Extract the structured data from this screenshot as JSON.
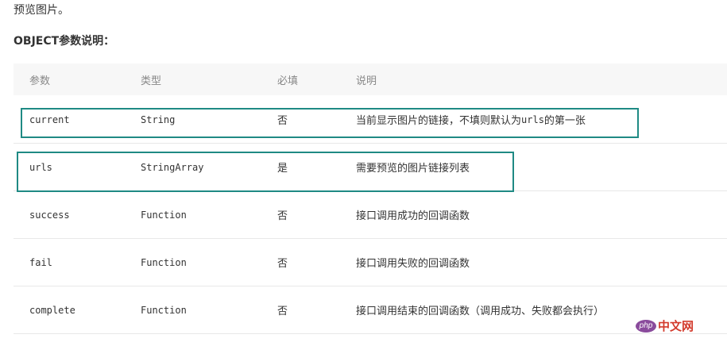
{
  "intro_text": "预览图片。",
  "section_title": "OBJECT参数说明：",
  "table": {
    "headers": {
      "param": "参数",
      "type": "类型",
      "required": "必填",
      "description": "说明"
    },
    "rows": [
      {
        "param": "current",
        "type": "String",
        "required": "否",
        "description_before": "当前显示图片的链接，不填则默认为 ",
        "description_code": "urls",
        "description_after": " 的第一张"
      },
      {
        "param": "urls",
        "type": "StringArray",
        "required": "是",
        "description": "需要预览的图片链接列表"
      },
      {
        "param": "success",
        "type": "Function",
        "required": "否",
        "description": "接口调用成功的回调函数"
      },
      {
        "param": "fail",
        "type": "Function",
        "required": "否",
        "description": "接口调用失败的回调函数"
      },
      {
        "param": "complete",
        "type": "Function",
        "required": "否",
        "description": "接口调用结束的回调函数（调用成功、失败都会执行）"
      }
    ]
  },
  "highlight_color": "#1f8a84",
  "watermark": {
    "logo": "php",
    "text": "中文网"
  }
}
